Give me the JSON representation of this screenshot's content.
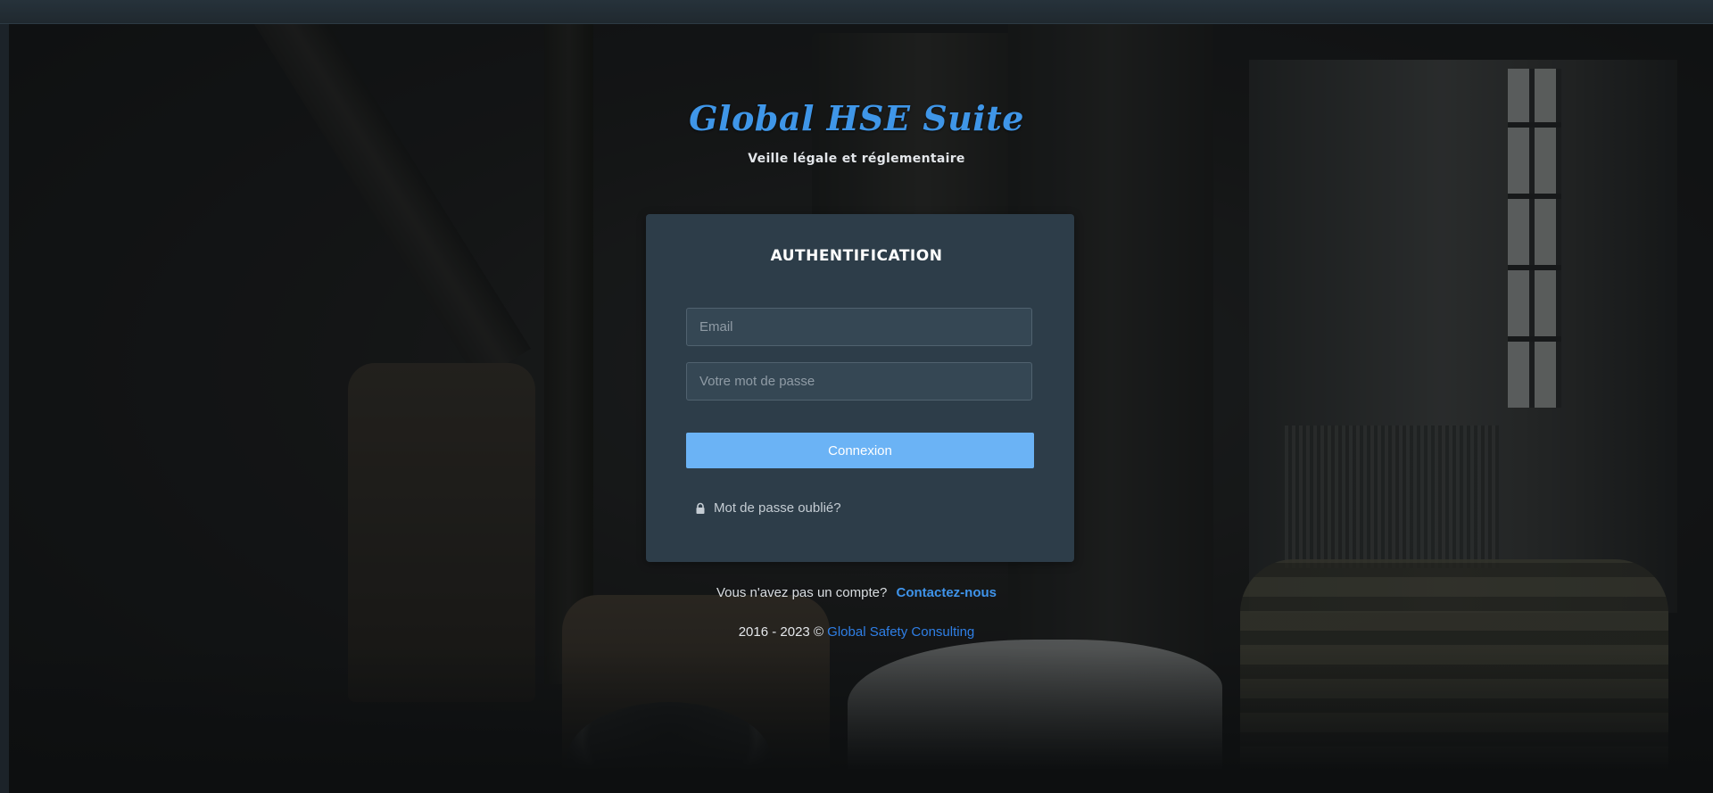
{
  "brand": {
    "title": "Global HSE Suite",
    "subtitle": "Veille légale et réglementaire"
  },
  "login": {
    "title": "AUTHENTIFICATION",
    "email_placeholder": "Email",
    "password_placeholder": "Votre mot de passe",
    "submit_label": "Connexion",
    "forgot_label": "Mot de passe oublié?",
    "forgot_icon": "lock-icon"
  },
  "signup": {
    "prompt": "Vous n'avez pas un compte?",
    "link_label": "Contactez-nous"
  },
  "footer": {
    "copyright": "2016 - 2023 ©",
    "company_link": "Global Safety Consulting"
  },
  "colors": {
    "brand_blue": "#3f96e8",
    "card_bg": "#2d3d49",
    "button_bg": "#6bb3f5",
    "link_blue": "#3f93ea"
  }
}
